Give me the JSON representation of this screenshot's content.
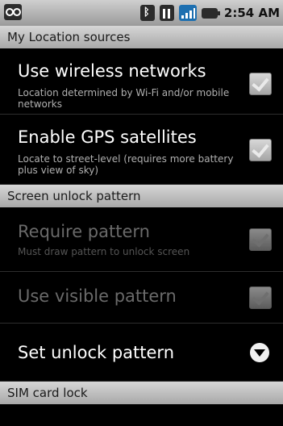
{
  "status_bar": {
    "time": "2:54 AM",
    "icons": [
      "voicemail-icon",
      "bluetooth-icon",
      "data-signal-icon",
      "signal-strength-icon",
      "battery-icon"
    ]
  },
  "sections": {
    "location": "My Location sources",
    "unlock": "Screen unlock pattern",
    "sim": "SIM card lock"
  },
  "items": {
    "wireless": {
      "title": "Use wireless networks",
      "summary": "Location determined by Wi-Fi and/or mobile networks",
      "checked": true
    },
    "gps": {
      "title": "Enable GPS satellites",
      "summary": "Locate to street-level (requires more battery plus view of sky)",
      "checked": true
    },
    "require_pattern": {
      "title": "Require pattern",
      "summary": "Must draw pattern to unlock screen",
      "checked": true,
      "enabled": false
    },
    "visible_pattern": {
      "title": "Use visible pattern",
      "checked": true,
      "enabled": false
    },
    "set_pattern": {
      "title": "Set unlock pattern"
    }
  },
  "colors": {
    "header_bg": "#bdbdbd",
    "checkmark": "#3a9a3a",
    "disabled_text": "#6a6a6a"
  }
}
